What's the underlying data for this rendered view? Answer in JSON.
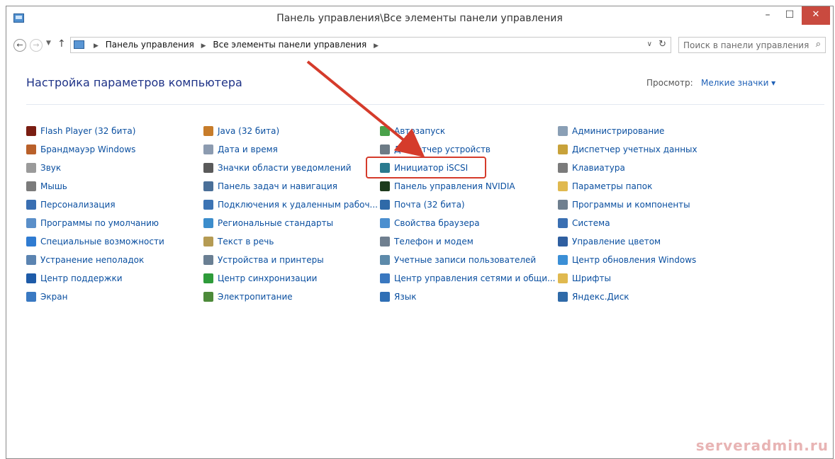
{
  "window": {
    "title": "Панель управления\\Все элементы панели управления"
  },
  "buttons": {
    "minimize": "–",
    "maximize": "☐",
    "close": "✕"
  },
  "address": {
    "crumbs": [
      "Панель управления",
      "Все элементы панели управления"
    ],
    "search_placeholder": "Поиск в панели управления"
  },
  "content": {
    "heading": "Настройка параметров компьютера",
    "view_label": "Просмотр:",
    "view_value": "Мелкие значки ▾"
  },
  "columns": [
    [
      {
        "label": "Flash Player (32 бита)",
        "icon": "flash-icon",
        "color": "#7a1d12"
      },
      {
        "label": "Брандмауэр Windows",
        "icon": "firewall-icon",
        "color": "#b9602a"
      },
      {
        "label": "Звук",
        "icon": "speaker-icon",
        "color": "#9a9a9a"
      },
      {
        "label": "Мышь",
        "icon": "mouse-icon",
        "color": "#7b7b7b"
      },
      {
        "label": "Персонализация",
        "icon": "personalization-icon",
        "color": "#3a6fb2"
      },
      {
        "label": "Программы по умолчанию",
        "icon": "default-programs-icon",
        "color": "#5a8fc9"
      },
      {
        "label": "Специальные возможности",
        "icon": "accessibility-icon",
        "color": "#2f7bd1"
      },
      {
        "label": "Устранение неполадок",
        "icon": "troubleshoot-icon",
        "color": "#5b84b1"
      },
      {
        "label": "Центр поддержки",
        "icon": "flag-icon",
        "color": "#1e5ba8"
      },
      {
        "label": "Экран",
        "icon": "display-icon",
        "color": "#3a79c2"
      }
    ],
    [
      {
        "label": "Java (32 бита)",
        "icon": "java-icon",
        "color": "#c77c2a"
      },
      {
        "label": "Дата и время",
        "icon": "clock-icon",
        "color": "#8c9bb0"
      },
      {
        "label": "Значки области уведомлений",
        "icon": "tray-icon",
        "color": "#5a5a5a"
      },
      {
        "label": "Панель задач и навигация",
        "icon": "taskbar-icon",
        "color": "#4a6f98"
      },
      {
        "label": "Подключения к удаленным рабоч...",
        "icon": "remote-icon",
        "color": "#3c74b4"
      },
      {
        "label": "Региональные стандарты",
        "icon": "globe-icon",
        "color": "#3c8dcc"
      },
      {
        "label": "Текст в речь",
        "icon": "speech-icon",
        "color": "#b59b53"
      },
      {
        "label": "Устройства и принтеры",
        "icon": "printer-icon",
        "color": "#6a7f93"
      },
      {
        "label": "Центр синхронизации",
        "icon": "sync-icon",
        "color": "#2e9b3a"
      },
      {
        "label": "Электропитание",
        "icon": "power-icon",
        "color": "#4d8a3a"
      }
    ],
    [
      {
        "label": "Автозапуск",
        "icon": "autoplay-icon",
        "color": "#4aa14a"
      },
      {
        "label": "Диспетчер устройств",
        "icon": "device-manager-icon",
        "color": "#6d7b86"
      },
      {
        "label": "Инициатор iSCSI",
        "icon": "iscsi-icon",
        "color": "#2a7a8f"
      },
      {
        "label": "Панель управления NVIDIA",
        "icon": "nvidia-icon",
        "color": "#1d3b1d"
      },
      {
        "label": "Почта (32 бита)",
        "icon": "mail-icon",
        "color": "#2f6aa8"
      },
      {
        "label": "Свойства браузера",
        "icon": "browser-icon",
        "color": "#4b8fcf"
      },
      {
        "label": "Телефон и модем",
        "icon": "phone-icon",
        "color": "#6f7f8f"
      },
      {
        "label": "Учетные записи пользователей",
        "icon": "users-icon",
        "color": "#5d8aaa"
      },
      {
        "label": "Центр управления сетями и общи...",
        "icon": "network-icon",
        "color": "#3a78c0"
      },
      {
        "label": "Язык",
        "icon": "language-icon",
        "color": "#2f6fb5"
      }
    ],
    [
      {
        "label": "Администрирование",
        "icon": "admin-tools-icon",
        "color": "#8a9fb5"
      },
      {
        "label": "Диспетчер учетных данных",
        "icon": "credential-icon",
        "color": "#c8a23a"
      },
      {
        "label": "Клавиатура",
        "icon": "keyboard-icon",
        "color": "#7b7b7b"
      },
      {
        "label": "Параметры папок",
        "icon": "folder-options-icon",
        "color": "#e0b94f"
      },
      {
        "label": "Программы и компоненты",
        "icon": "programs-icon",
        "color": "#6f7f8f"
      },
      {
        "label": "Система",
        "icon": "system-icon",
        "color": "#3a6fb2"
      },
      {
        "label": "Управление цветом",
        "icon": "color-management-icon",
        "color": "#2f5fa0"
      },
      {
        "label": "Центр обновления Windows",
        "icon": "windows-update-icon",
        "color": "#3b8fd6"
      },
      {
        "label": "Шрифты",
        "icon": "fonts-icon",
        "color": "#e0b94f"
      },
      {
        "label": "Яндекс.Диск",
        "icon": "cloud-icon",
        "color": "#2f6aa8"
      }
    ]
  ],
  "watermark": "serveradmin.ru"
}
